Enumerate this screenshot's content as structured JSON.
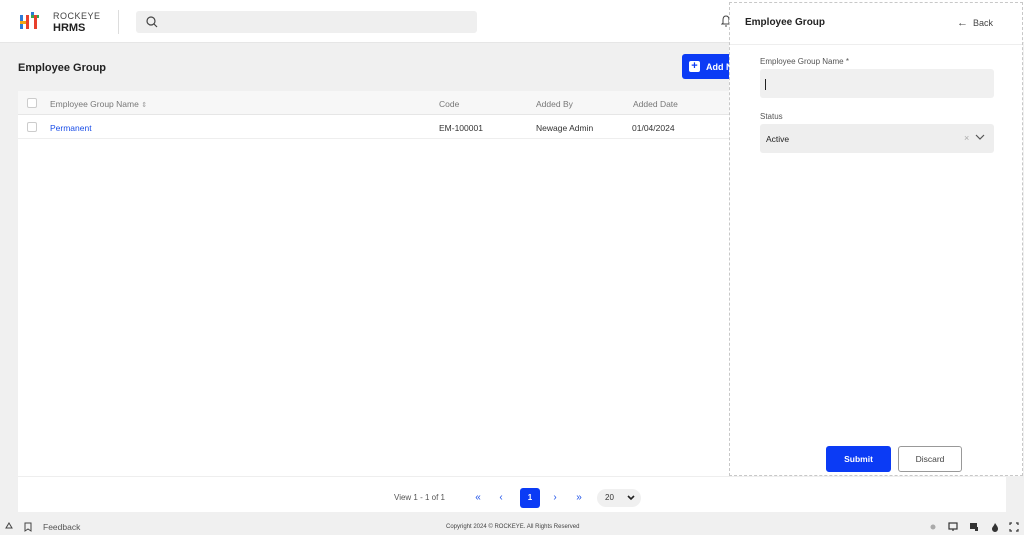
{
  "header": {
    "brand_line1": "ROCKEYE",
    "brand_line2": "HRMS",
    "search_placeholder": ""
  },
  "page": {
    "title": "Employee Group",
    "add_button_label": "Add N"
  },
  "table": {
    "columns": [
      "Employee Group Name",
      "Code",
      "Added By",
      "Added Date"
    ],
    "sort_indicator": "⇕",
    "rows": [
      {
        "name": "Permanent",
        "code": "EM-100001",
        "added_by": "Newage Admin",
        "added_date": "01/04/2024"
      }
    ]
  },
  "pagination": {
    "view_text": "View 1 - 1 of 1",
    "first": "«",
    "prev": "‹",
    "current_page": "1",
    "next": "›",
    "last": "»",
    "page_size": "20"
  },
  "footer": {
    "feedback": "Feedback",
    "copyright": "Copyright 2024 © ROCKEYE. All Rights Reserved"
  },
  "panel": {
    "title": "Employee Group",
    "back_label": "Back",
    "name_label": "Employee Group Name *",
    "name_value": "",
    "status_label": "Status",
    "status_value": "Active",
    "clear_glyph": "×",
    "submit_label": "Submit",
    "discard_label": "Discard"
  },
  "colors": {
    "primary": "#0b3bf5",
    "link": "#1a4ee8"
  }
}
